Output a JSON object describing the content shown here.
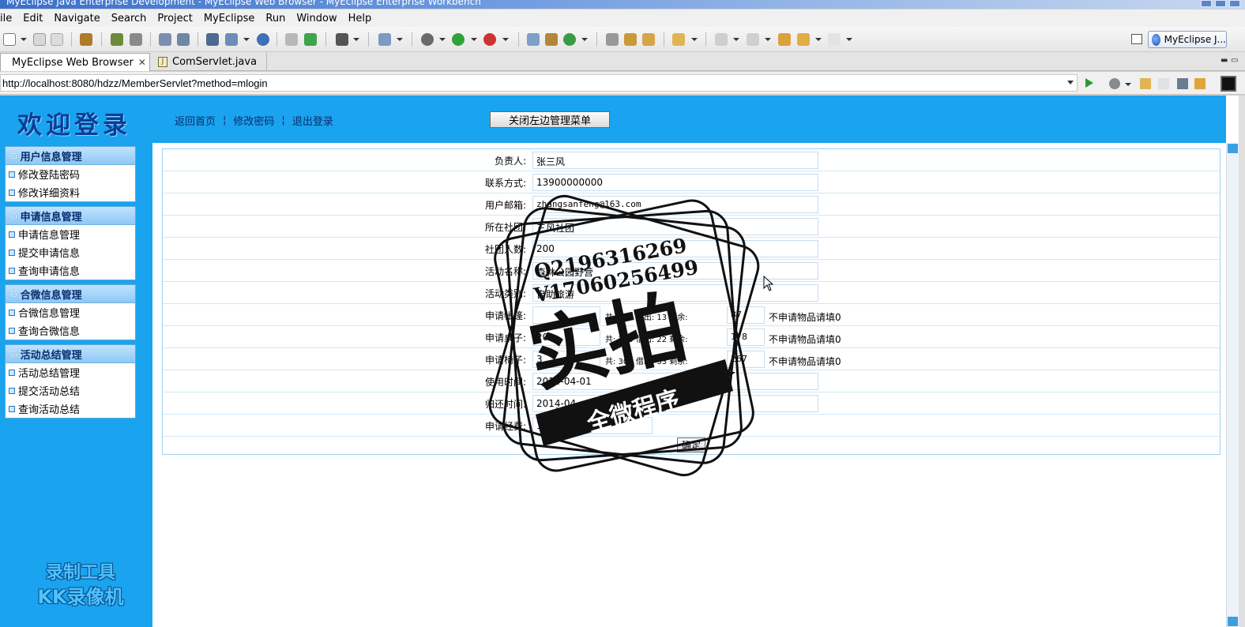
{
  "window": {
    "title": "MyEclipse Java Enterprise Development - MyEclipse Web Browser - MyEclipse Enterprise Workbench"
  },
  "menubar": [
    "ile",
    "Edit",
    "Navigate",
    "Search",
    "Project",
    "MyEclipse",
    "Run",
    "Window",
    "Help"
  ],
  "toolbar": {
    "perspective_label": "MyEclipse J..."
  },
  "tabs": {
    "browser": "MyEclipse Web Browser",
    "java": "ComServlet.java",
    "java_icon": "J"
  },
  "address": {
    "url": "http://localhost:8080/hdzz/MemberServlet?method=mlogin"
  },
  "header": {
    "welcome": "欢迎登录",
    "link_home": "返回首页",
    "link_password": "修改密码",
    "link_logout": "退出登录",
    "separator": "¦",
    "toggle_menu": "关闭左边管理菜单"
  },
  "sidebar": {
    "groups": [
      {
        "title": "用户信息管理",
        "items": [
          "修改登陆密码",
          "修改详细资料"
        ]
      },
      {
        "title": "申请信息管理",
        "items": [
          "申请信息管理",
          "提交申请信息",
          "查询申请信息"
        ]
      },
      {
        "title": "合微信息管理",
        "items": [
          "合微信息管理",
          "查询合微信息"
        ]
      },
      {
        "title": "活动总结管理",
        "items": [
          "活动总结管理",
          "提交活动总结",
          "查询活动总结"
        ]
      }
    ],
    "watermark_line1": "录制工具",
    "watermark_line2": "KK录像机"
  },
  "form": {
    "rows": [
      {
        "label": "负责人:",
        "value": "张三风"
      },
      {
        "label": "联系方式:",
        "value": "13900000000"
      },
      {
        "label": "用户邮箱:",
        "value": "zhangsanfeng@163.com"
      },
      {
        "label": "所在社团:",
        "value": "三风社团"
      },
      {
        "label": "社团人数:",
        "value": "200"
      },
      {
        "label": "活动名称:",
        "value": "森林公园野营"
      },
      {
        "label": "活动类别:",
        "value": "自助旅游"
      },
      {
        "label": "申请帐篷:",
        "value": "",
        "stock": "共: 100 借出: 13 剩余:",
        "remain": "87",
        "note": "不申请物品请填0"
      },
      {
        "label": "申请桌子:",
        "value": "20",
        "stock": "共: 100 借出: 22 剩余:",
        "remain": "178",
        "note": "不申请物品请填0"
      },
      {
        "label": "申请椅子:",
        "value": "3",
        "stock": "共: 300 借出: 33 剩余:",
        "remain": "267",
        "note": "不申请物品请填0"
      },
      {
        "label": "使用时间:",
        "value": "2014-04-01"
      },
      {
        "label": "归还时间:",
        "value": "2014-04"
      },
      {
        "label": "申请经费:",
        "value": "1000"
      }
    ],
    "submit": "确定"
  },
  "stamp": {
    "line1": "Q2196316269",
    "line2": "V17060256499",
    "main": "实拍",
    "ribbon": "全微程序"
  },
  "colors": {
    "page_blue": "#1aa3ee",
    "header_text": "#0a3d96"
  }
}
